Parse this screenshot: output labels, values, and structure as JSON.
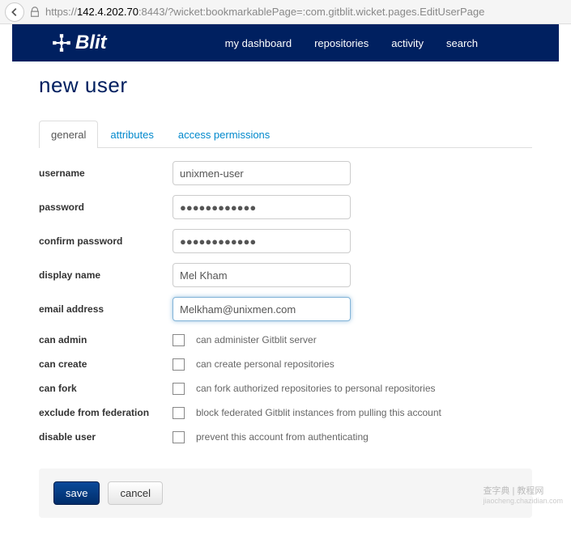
{
  "url": {
    "prefix": "https://",
    "host": "142.4.202.70",
    "rest": ":8443/?wicket:bookmarkablePage=:com.gitblit.wicket.pages.EditUserPage"
  },
  "brand": "Blit",
  "nav": {
    "dashboard": "my dashboard",
    "repositories": "repositories",
    "activity": "activity",
    "search": "search"
  },
  "page_title": "new user",
  "tabs": {
    "general": "general",
    "attributes": "attributes",
    "access": "access permissions"
  },
  "fields": {
    "username": {
      "label": "username",
      "value": "unixmen-user"
    },
    "password": {
      "label": "password",
      "value": "●●●●●●●●●●●●"
    },
    "confirm": {
      "label": "confirm password",
      "value": "●●●●●●●●●●●●"
    },
    "display": {
      "label": "display name",
      "value": "Mel Kham"
    },
    "email": {
      "label": "email address",
      "value": "Melkham@unixmen.com"
    }
  },
  "checks": {
    "admin": {
      "label": "can admin",
      "desc": "can administer Gitblit server"
    },
    "create": {
      "label": "can create",
      "desc": "can create personal repositories"
    },
    "fork": {
      "label": "can fork",
      "desc": "can fork authorized repositories to personal repositories"
    },
    "exclude": {
      "label": "exclude from federation",
      "desc": "block federated Gitblit instances from pulling this account"
    },
    "disable": {
      "label": "disable user",
      "desc": "prevent this account from authenticating"
    }
  },
  "buttons": {
    "save": "save",
    "cancel": "cancel"
  },
  "watermark": {
    "main": "查字典 | 教程网",
    "sub": "jiaocheng.chazidian.com"
  }
}
